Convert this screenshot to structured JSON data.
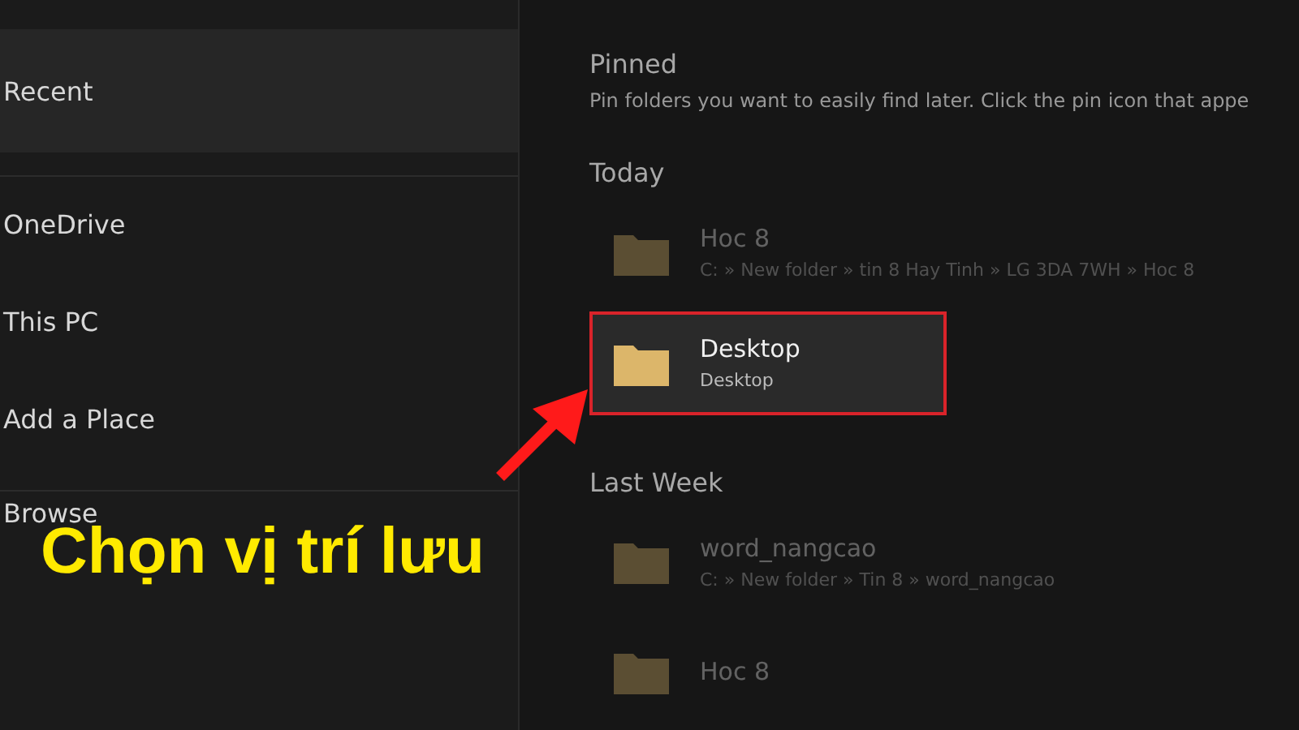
{
  "sidebar": {
    "items": [
      {
        "label": "Recent",
        "selected": true
      },
      {
        "label": "OneDrive",
        "selected": false
      },
      {
        "label": "This PC",
        "selected": false
      },
      {
        "label": "Add a Place",
        "selected": false
      },
      {
        "label": "Browse",
        "selected": false
      }
    ]
  },
  "pinned": {
    "title": "Pinned",
    "description": "Pin folders you want to easily find later. Click the pin icon that appe"
  },
  "groups": [
    {
      "title": "Today",
      "items": [
        {
          "name": "Hoc 8",
          "path": "C: » New folder » tin 8 Hay Tinh » LG 3DA 7WH » Hoc 8",
          "selected": false
        },
        {
          "name": "Desktop",
          "path": "Desktop",
          "selected": true
        }
      ]
    },
    {
      "title": "Last Week",
      "items": [
        {
          "name": "word_nangcao",
          "path": "C: » New folder » Tin 8 » word_nangcao",
          "selected": false
        },
        {
          "name": "Hoc 8",
          "selected": false
        }
      ]
    }
  ],
  "caption": "Chọn vị trí lưu"
}
